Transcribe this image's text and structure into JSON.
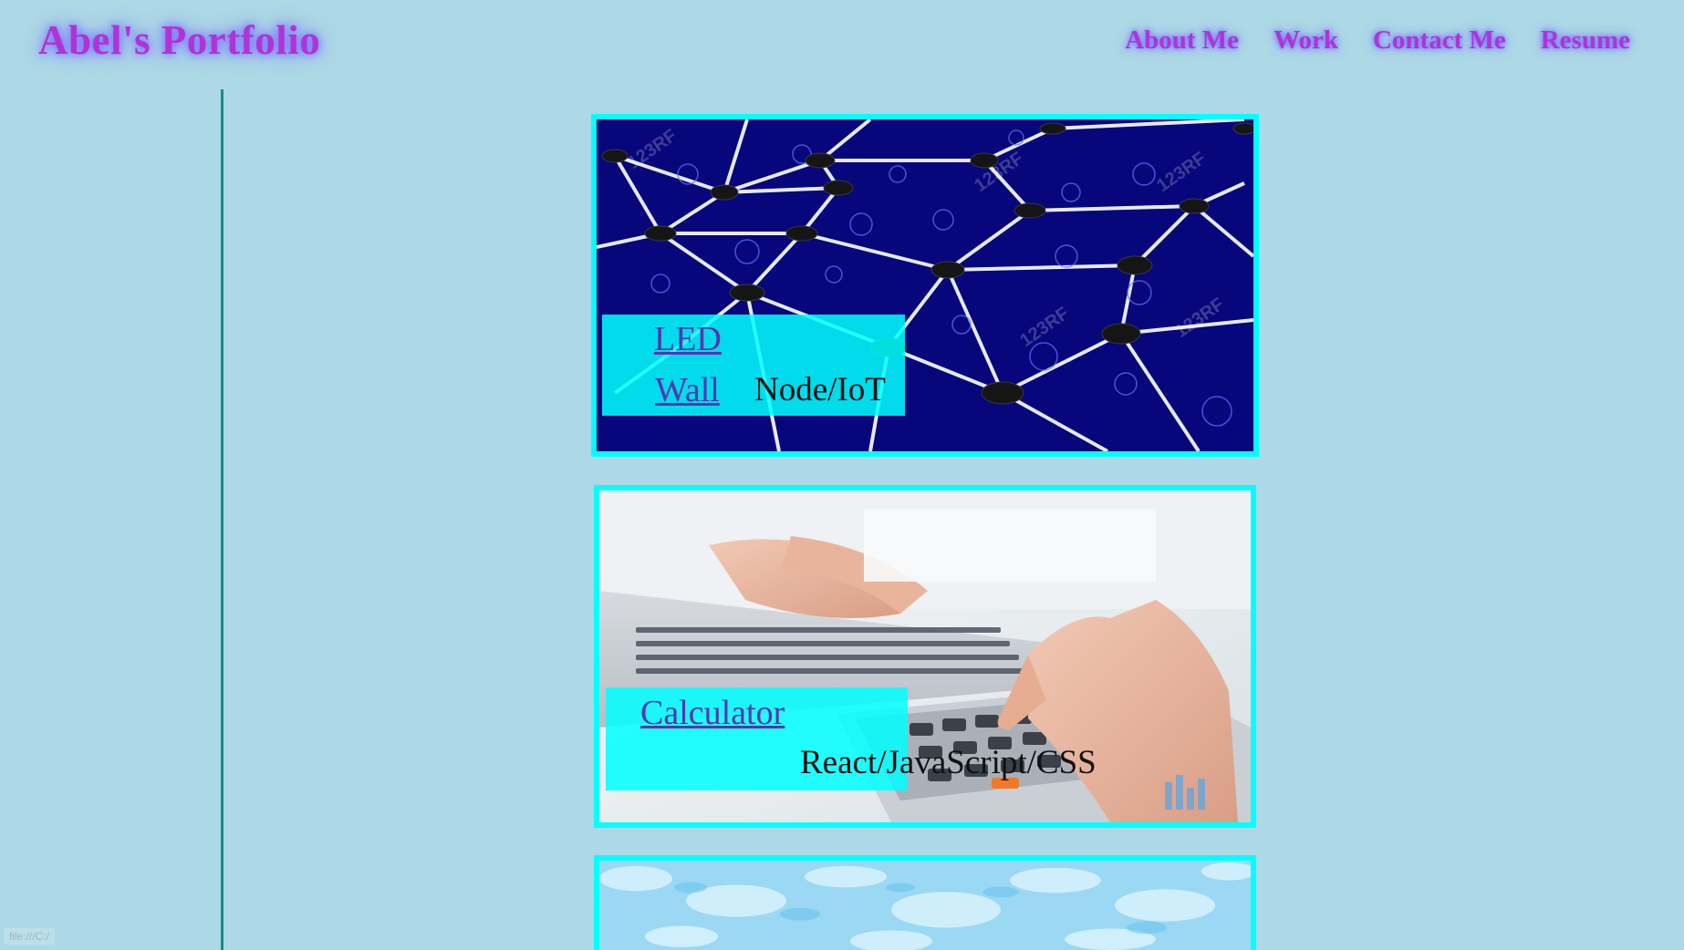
{
  "header": {
    "title": "Abel's Portfolio",
    "nav": [
      "About Me",
      "Work",
      "Contact Me",
      "Resume"
    ]
  },
  "projects": [
    {
      "name_line1": "LED",
      "name_line2": "Wall",
      "tech": "Node/IoT"
    },
    {
      "name": "Calculator",
      "tech": "React/JavaScript/CSS"
    }
  ],
  "status_bar": {
    "text": "file:///C:/"
  },
  "icons": [
    "network-nodes-image",
    "calculator-keyboard-image",
    "watercolor-texture-image"
  ],
  "colors": {
    "background": "#add8e6",
    "title": "#b033d6",
    "card_border": "#00ffff",
    "caption_bg": "#00ffff",
    "link": "#5a34b0",
    "sidebar_line": "#168b8a"
  }
}
